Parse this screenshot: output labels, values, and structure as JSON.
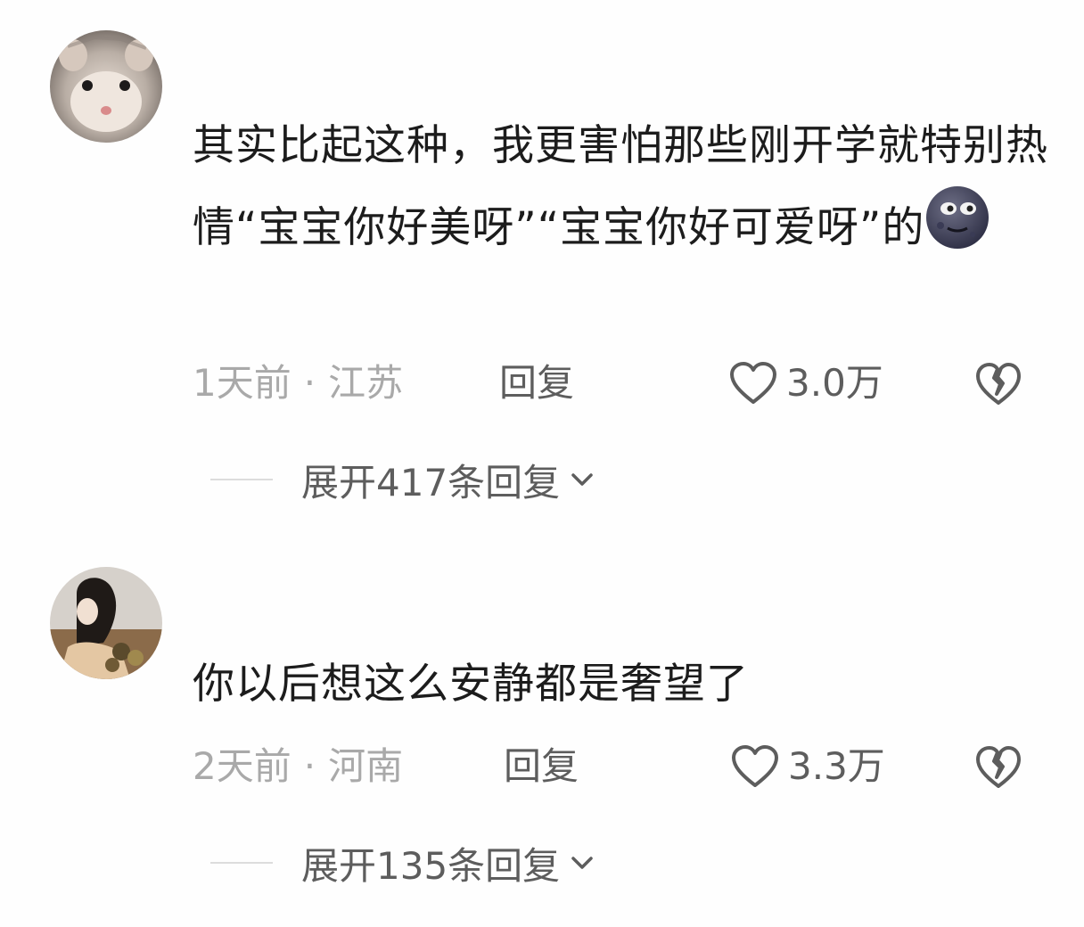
{
  "comments": [
    {
      "text": "其实比起这种，我更害怕那些刚开学就特别热情“宝宝你好美呀”“宝宝你好可爱呀”的",
      "emoji": "new-moon-face-icon",
      "time": "1天前",
      "location": "江苏",
      "reply_label": "回复",
      "likes": "3.0万",
      "expand_label": "展开417条回复"
    },
    {
      "text": "你以后想这么安静都是奢望了",
      "time": "2天前",
      "location": "河南",
      "reply_label": "回复",
      "likes": "3.3万",
      "expand_label": "展开135条回复"
    }
  ],
  "separator": "·"
}
